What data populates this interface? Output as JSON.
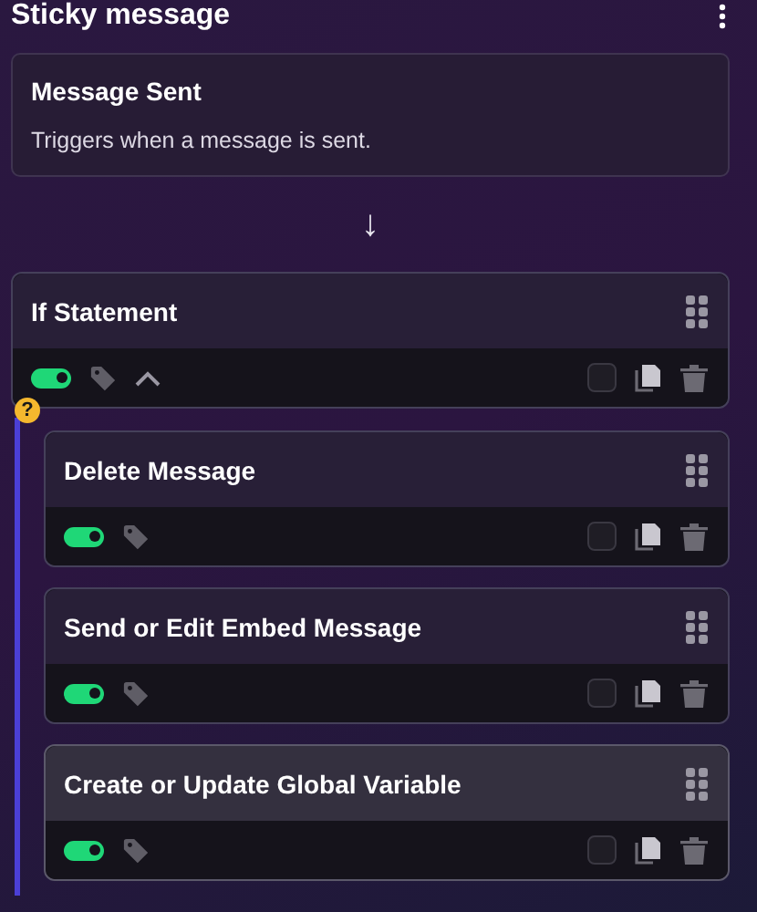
{
  "title": "Sticky message",
  "trigger": {
    "title": "Message Sent",
    "description": "Triggers when a message is sent."
  },
  "flow_arrow": "↓",
  "condition": {
    "title": "If Statement",
    "enabled": true,
    "expanded": true,
    "checked": false,
    "badge": "?",
    "children": [
      {
        "title": "Delete Message",
        "enabled": true,
        "checked": false,
        "highlighted": false
      },
      {
        "title": "Send or Edit Embed Message",
        "enabled": true,
        "checked": false,
        "highlighted": false
      },
      {
        "title": "Create or Update Global Variable",
        "enabled": true,
        "checked": false,
        "highlighted": true
      }
    ]
  }
}
